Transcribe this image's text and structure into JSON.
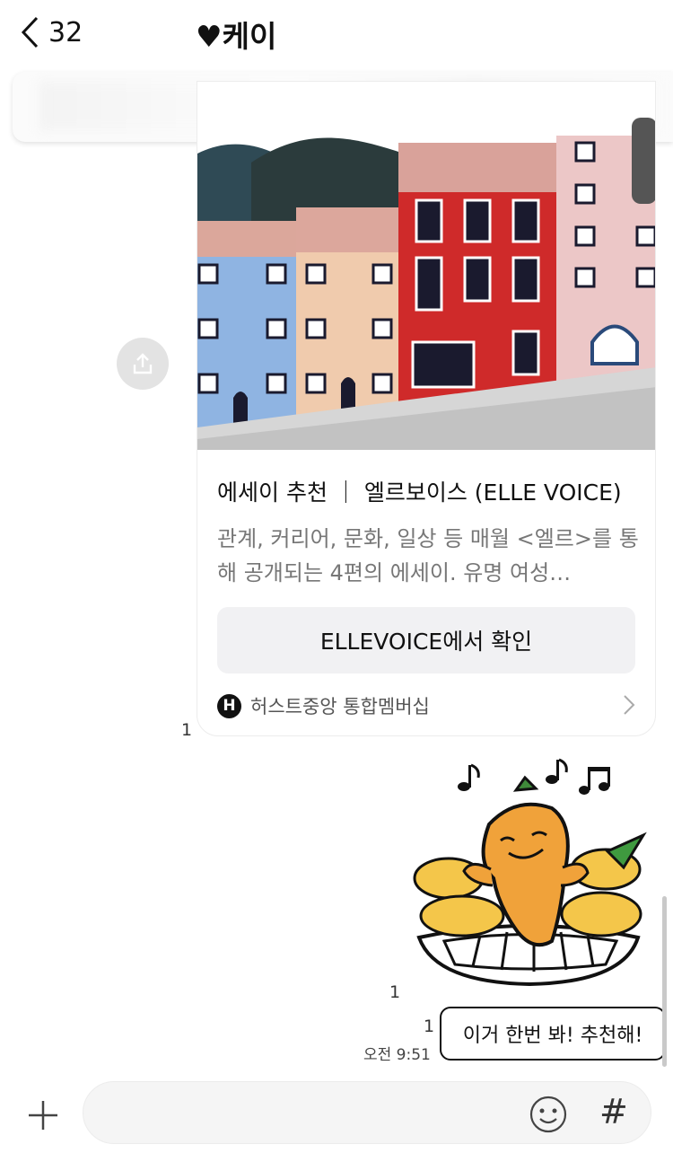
{
  "header": {
    "back_count": "32",
    "title": "♥케이"
  },
  "card": {
    "title": "에세이 추천 ｜ 엘르보이스 (ELLE VOICE)",
    "description": "관계, 커리어, 문화, 일상 등 매월 <엘르>를 통해 공개되는 4편의 에세이. 유명 여성…",
    "button_label": "ELLEVOICE에서 확인",
    "brand_icon_letter": "H",
    "brand_name": "허스트중앙 통합멤버십",
    "read_count": "1"
  },
  "sticker": {
    "read_count": "1"
  },
  "message": {
    "text": "이거 한번 봐! 추천해!",
    "read_count": "1",
    "time": "오전 9:51"
  },
  "input": {
    "placeholder": ""
  },
  "colors": {
    "bubble_border": "#111111",
    "card_button_bg": "#f1f1f3",
    "share_bg": "#e3e3e3"
  }
}
